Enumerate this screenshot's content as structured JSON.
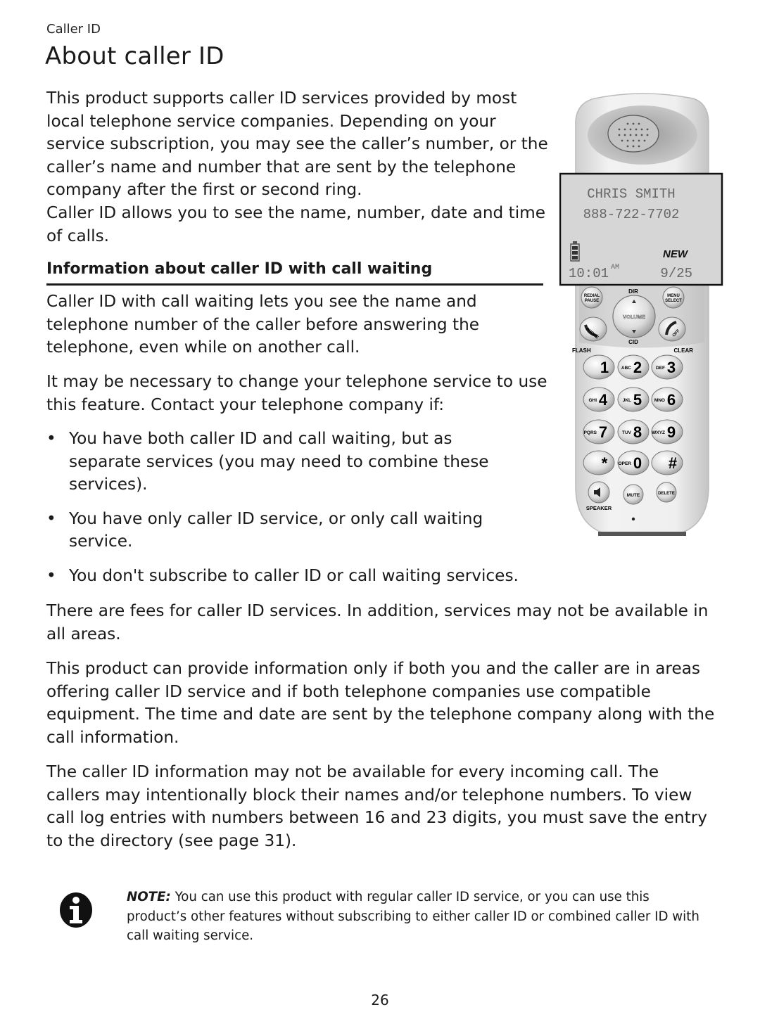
{
  "header": {
    "section_label": "Caller ID",
    "title": "About caller ID"
  },
  "intro": {
    "paragraph": "This product supports caller ID services provided by most local telephone service companies. Depending on your service subscription, you may see the caller’s number, or the caller’s name and number that are sent by the telephone company after the first or second ring.",
    "paragraph2": "Caller ID allows you to see the name, number, date and time of calls."
  },
  "call_waiting": {
    "heading": "Information about caller ID with call waiting",
    "p1": "Caller ID with call waiting lets you see the name and telephone number of the caller before answering the telephone, even while on another call.",
    "p2": "It may be necessary to change your telephone service to use this feature. Contact your telephone company if:",
    "bullets": [
      "You have both caller ID and call waiting, but as separate services (you may need to combine these services).",
      "You have only caller ID service, or only call waiting service.",
      "You don't subscribe to caller ID or call waiting services."
    ],
    "bullet_glyph": "•"
  },
  "paragraphs": {
    "fees": "There are fees for caller ID services. In addition, services may not be available in all areas.",
    "provide": "This product can provide information only if both you and the caller are in areas offering caller ID service and if both telephone companies use compatible equipment. The time and date are sent by the telephone company along with the call information.",
    "unavailable": "The caller ID information may not be available for every incoming call. The callers may intentionally block their names and/or telephone numbers. To view call log entries with numbers between 16 and 23 digits, you must save the entry to the directory (see page 31)."
  },
  "note": {
    "label": "NOTE:",
    "text": " You can use this product with regular caller ID service, or you can use this product’s other features without subscribing to either caller ID or combined caller ID with call waiting service.",
    "icon": "info-icon"
  },
  "phone_illustration": {
    "screen": {
      "caller_name": "CHRIS SMITH",
      "caller_number": "888-722-7702",
      "badge": "NEW",
      "time": "10:01",
      "ampm": "AM",
      "date": "9/25",
      "battery_icon": "battery-icon"
    },
    "buttons": {
      "redial_top": "REDIAL",
      "redial_bottom": "PAUSE",
      "menu_top": "MENU",
      "menu_bottom": "SELECT",
      "dir": "DIR",
      "volume": "VOLUME",
      "cid": "CID",
      "phone": "PHONE",
      "off": "OFF",
      "flash": "FLASH",
      "clear": "CLEAR",
      "speaker": "SPEAKER",
      "mute": "MUTE",
      "delete": "DELETE"
    },
    "keypad": [
      {
        "letters": "",
        "digit": "1"
      },
      {
        "letters": "ABC",
        "digit": "2"
      },
      {
        "letters": "DEF",
        "digit": "3"
      },
      {
        "letters": "GHI",
        "digit": "4"
      },
      {
        "letters": "JKL",
        "digit": "5"
      },
      {
        "letters": "MNO",
        "digit": "6"
      },
      {
        "letters": "PQRS",
        "digit": "7"
      },
      {
        "letters": "TUV",
        "digit": "8"
      },
      {
        "letters": "WXYZ",
        "digit": "9"
      },
      {
        "letters": "",
        "digit": "*"
      },
      {
        "letters": "OPER",
        "digit": "0"
      },
      {
        "letters": "",
        "digit": "#"
      }
    ]
  },
  "footer": {
    "page_number": "26"
  }
}
